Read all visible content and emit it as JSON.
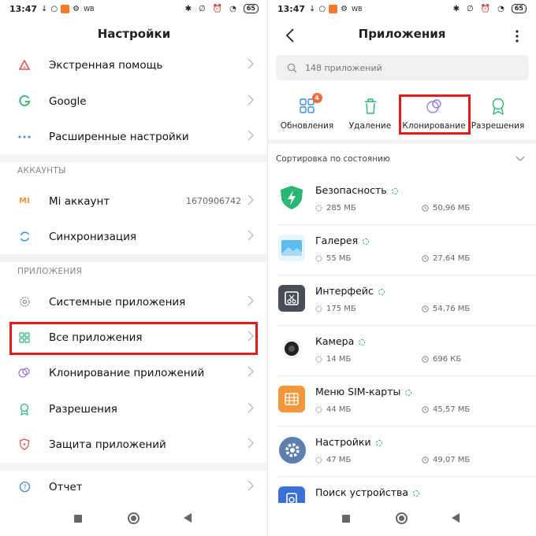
{
  "status": {
    "time": "13:47",
    "wb": "WB",
    "battery": "65"
  },
  "left": {
    "title": "Настройки",
    "rows": [
      {
        "label": "Экстренная помощь"
      },
      {
        "label": "Google"
      },
      {
        "label": "Расширенные настройки"
      },
      {
        "label": "Mi аккаунт",
        "value": "1670906742"
      },
      {
        "label": "Синхронизация"
      },
      {
        "label": "Системные приложения"
      },
      {
        "label": "Все приложения"
      },
      {
        "label": "Клонирование приложений"
      },
      {
        "label": "Разрешения"
      },
      {
        "label": "Защита приложений"
      },
      {
        "label": "Отчет"
      }
    ],
    "sections": {
      "accounts": "АККАУНТЫ",
      "apps": "ПРИЛОЖЕНИЯ"
    },
    "icons": {
      "mi": "MI"
    }
  },
  "right": {
    "title": "Приложения",
    "search": {
      "placeholder": "148 приложений"
    },
    "tabs": [
      {
        "label": "Обновления",
        "badge": "4"
      },
      {
        "label": "Удаление"
      },
      {
        "label": "Клонирование"
      },
      {
        "label": "Разрешения"
      }
    ],
    "sort_label": "Сортировка по состоянию",
    "apps": [
      {
        "name": "Безопасность",
        "size": "285 МБ",
        "data": "50,96 МБ",
        "color": "#2bb673"
      },
      {
        "name": "Галерея",
        "size": "55 МБ",
        "data": "27,64 МБ",
        "color": "#3aa7e8"
      },
      {
        "name": "Интерфейс",
        "size": "175 МБ",
        "data": "54,76 МБ",
        "color": "#4a4d55"
      },
      {
        "name": "Камера",
        "size": "14 МБ",
        "data": "696 КБ",
        "color": "#222222"
      },
      {
        "name": "Меню SIM-карты",
        "size": "44 МБ",
        "data": "45,57 МБ",
        "color": "#f5963a"
      },
      {
        "name": "Настройки",
        "size": "47 МБ",
        "data": "49,07 МБ",
        "color": "#5d7fae"
      },
      {
        "name": "Поиск устройства",
        "size": "",
        "data": "",
        "color": "#3b6fd8"
      }
    ]
  },
  "colors": {
    "highlight": "#e21c1c",
    "accent_green": "#2ab573",
    "badge": "#f06a3c"
  }
}
